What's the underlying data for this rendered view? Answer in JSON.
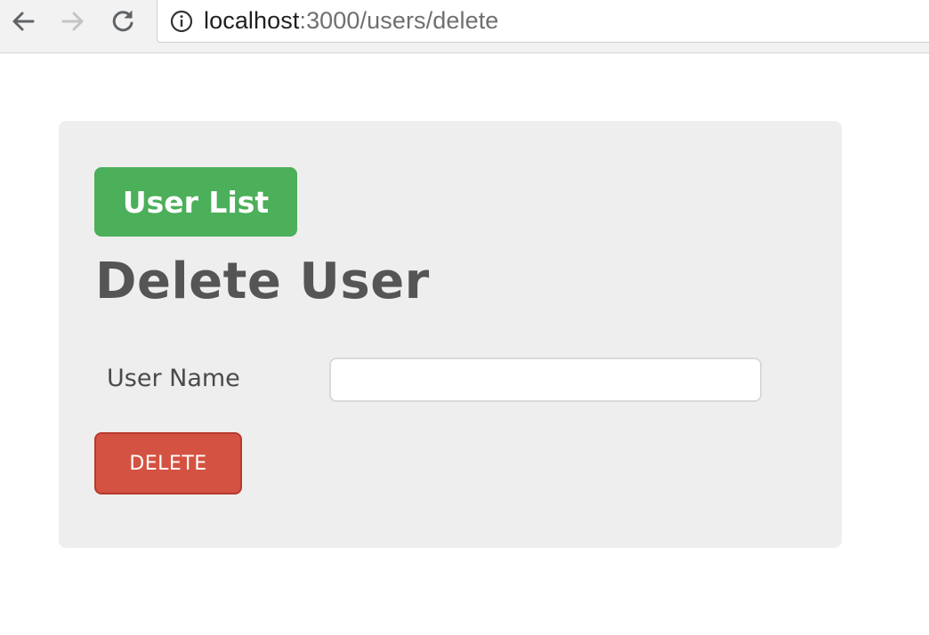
{
  "browser": {
    "url_host": "localhost",
    "url_path": ":3000/users/delete",
    "icons": {
      "back": "arrow-left-icon",
      "forward": "arrow-right-icon",
      "reload": "reload-icon",
      "site_info": "info-icon"
    }
  },
  "page": {
    "user_list_button": "User List",
    "title": "Delete User",
    "form": {
      "username_label": "User Name",
      "username_value": "",
      "delete_button": "DELETE"
    }
  },
  "colors": {
    "panel_bg": "#eeeeee",
    "user_list_button": "#4caf5a",
    "delete_button": "#d45242",
    "title_text": "#555555"
  }
}
